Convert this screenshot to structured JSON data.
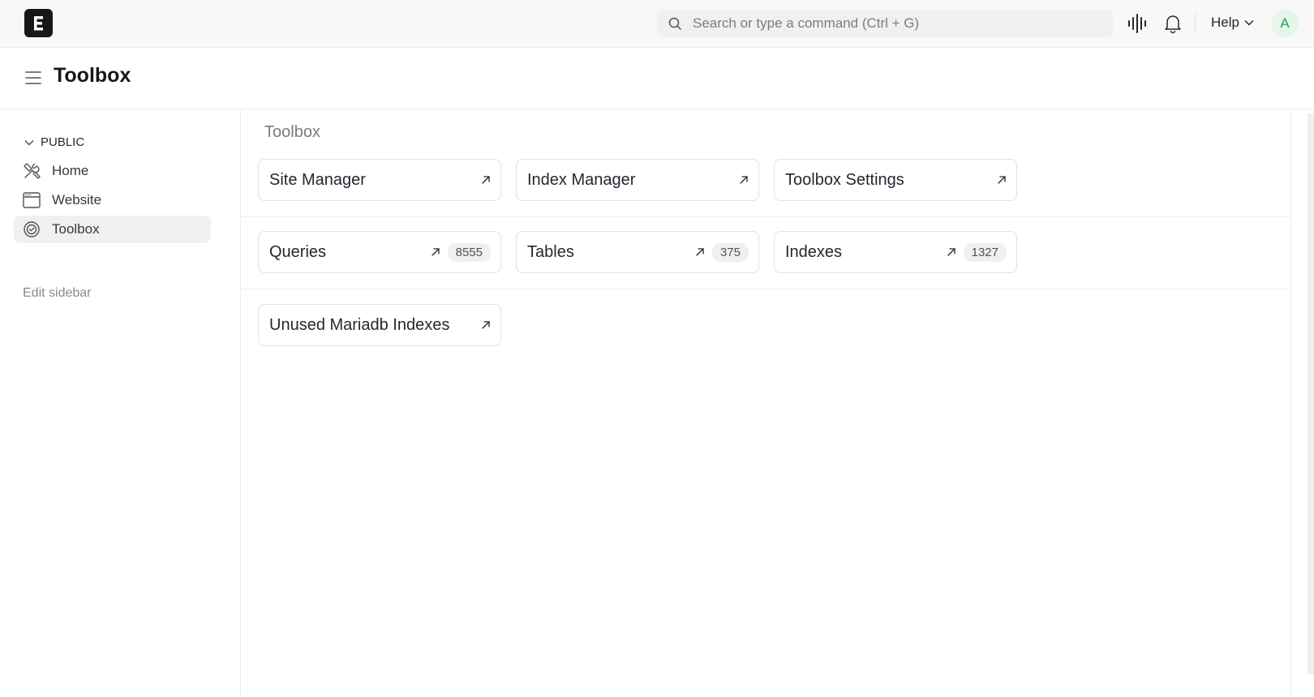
{
  "navbar": {
    "logo_letter": "E",
    "search_placeholder": "Search or type a command (Ctrl + G)",
    "help_label": "Help",
    "avatar_initial": "A",
    "icons": [
      "soundwave-icon",
      "bell-icon",
      "chevron-down-icon"
    ]
  },
  "page": {
    "title": "Toolbox"
  },
  "sidebar": {
    "section_label": "PUBLIC",
    "items": [
      {
        "label": "Home",
        "icon": "tools-icon",
        "active": false
      },
      {
        "label": "Website",
        "icon": "browser-window-icon",
        "active": false
      },
      {
        "label": "Toolbox",
        "icon": "badge-check-icon",
        "active": true
      }
    ],
    "edit_label": "Edit sidebar"
  },
  "main": {
    "section_title": "Toolbox",
    "rows": [
      [
        {
          "label": "Site Manager",
          "count": null
        },
        {
          "label": "Index Manager",
          "count": null
        },
        {
          "label": "Toolbox Settings",
          "count": null
        }
      ],
      [
        {
          "label": "Queries",
          "count": "8555"
        },
        {
          "label": "Tables",
          "count": "375"
        },
        {
          "label": "Indexes",
          "count": "1327"
        }
      ],
      [
        {
          "label": "Unused Mariadb Indexes",
          "count": null
        }
      ]
    ]
  },
  "colors": {
    "navbar_bg": "#f8f8f8",
    "text": "#1f272e",
    "muted": "#7c7c7c",
    "avatar_bg": "#e4f5ea",
    "avatar_text": "#2e9e5b"
  }
}
